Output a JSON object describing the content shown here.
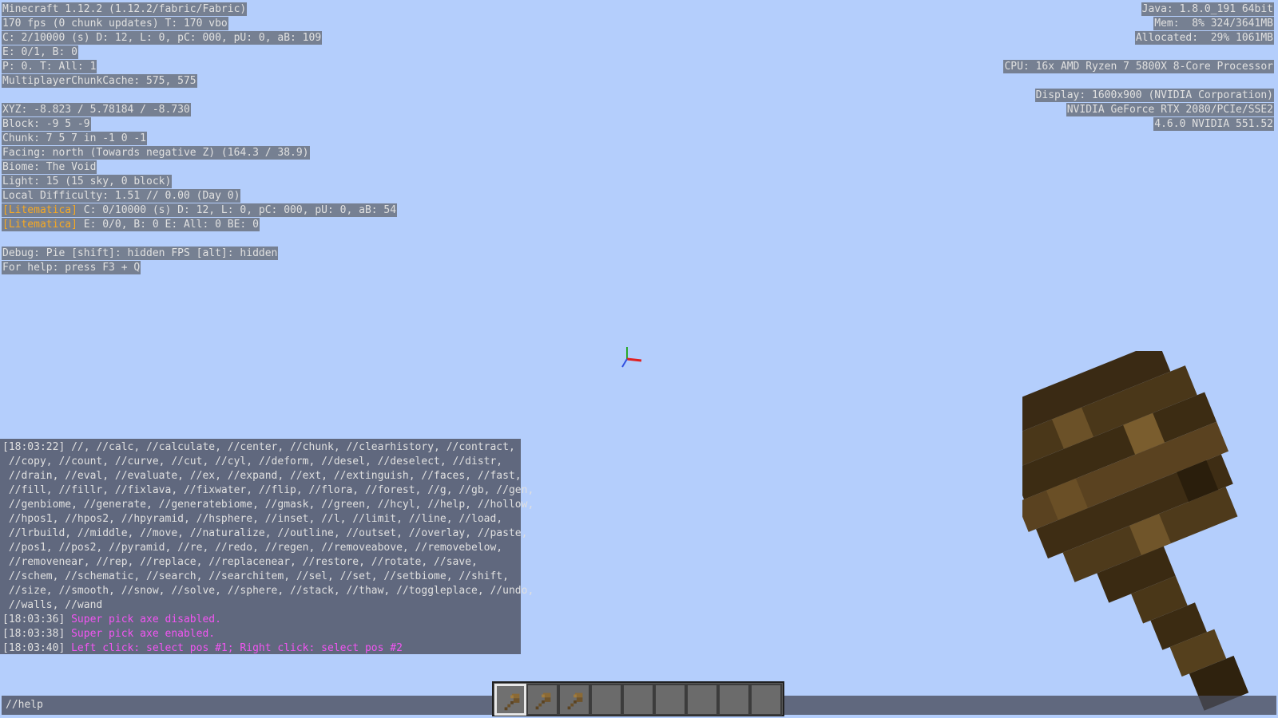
{
  "debug_left": {
    "lines": [
      "Minecraft 1.12.2 (1.12.2/fabric/Fabric)",
      "170 fps (0 chunk updates) T: 170 vbo",
      "C: 2/10000 (s) D: 12, L: 0, pC: 000, pU: 0, aB: 109",
      "E: 0/1, B: 0",
      "P: 0. T: All: 1",
      "MultiplayerChunkCache: 575, 575",
      "",
      "XYZ: -8.823 / 5.78184 / -8.730",
      "Block: -9 5 -9",
      "Chunk: 7 5 7 in -1 0 -1",
      "Facing: north (Towards negative Z) (164.3 / 38.9)",
      "Biome: The Void",
      "Light: 15 (15 sky, 0 block)",
      "Local Difficulty: 1.51 // 0.00 (Day 0)"
    ],
    "litematica_tag": "[Litematica]",
    "litematica_1": " C: 0/10000 (s) D: 12, L: 0, pC: 000, pU: 0, aB: 54",
    "litematica_2": " E: 0/0, B: 0 E: All: 0 BE: 0",
    "debug_pie": "Debug: Pie [shift]: hidden FPS [alt]: hidden",
    "help": "For help: press F3 + Q"
  },
  "debug_right": {
    "java": "Java: 1.8.0_191 64bit",
    "mem": "Mem:  8% 324/3641MB",
    "allocated": "Allocated:  29% 1061MB",
    "cpu": "CPU: 16x AMD Ryzen 7 5800X 8-Core Processor",
    "display": "Display: 1600x900 (NVIDIA Corporation)",
    "gpu": "NVIDIA GeForce RTX 2080/PCIe/SSE2",
    "driver": "4.6.0 NVIDIA 551.52"
  },
  "chat": {
    "lines": [
      "[18:03:22] //, //calc, //calculate, //center, //chunk, //clearhistory, //contract,",
      " //copy, //count, //curve, //cut, //cyl, //deform, //desel, //deselect, //distr,",
      " //drain, //eval, //evaluate, //ex, //expand, //ext, //extinguish, //faces, //fast,",
      " //fill, //fillr, //fixlava, //fixwater, //flip, //flora, //forest, //g, //gb, //gen,",
      " //genbiome, //generate, //generatebiome, //gmask, //green, //hcyl, //help, //hollow,",
      " //hpos1, //hpos2, //hpyramid, //hsphere, //inset, //l, //limit, //line, //load,",
      " //lrbuild, //middle, //move, //naturalize, //outline, //outset, //overlay, //paste,",
      " //pos1, //pos2, //pyramid, //re, //redo, //regen, //removeabove, //removebelow,",
      " //removenear, //rep, //replace, //replacenear, //restore, //rotate, //save,",
      " //schem, //schematic, //search, //searchitem, //sel, //set, //setbiome, //shift,",
      " //size, //smooth, //snow, //solve, //sphere, //stack, //thaw, //toggleplace, //undo,",
      " //walls, //wand"
    ],
    "msg1_time": "[18:03:36] ",
    "msg1_text": "Super pick axe disabled.",
    "msg2_time": "[18:03:38] ",
    "msg2_text": "Super pick axe enabled.",
    "msg3_time": "[18:03:40] ",
    "msg3_text": "Left click: select pos #1; Right click: select pos #2"
  },
  "chat_input": {
    "value": "//help"
  },
  "hotbar": {
    "selected_slot": 1,
    "slots": [
      "wooden-axe-icon",
      "wooden-axe-icon",
      "wooden-axe-icon",
      "",
      "",
      "",
      "",
      "",
      ""
    ]
  },
  "colors": {
    "sky": "#b4cefc",
    "litematica": "#f7a922",
    "chat_pink": "#f255f2"
  }
}
